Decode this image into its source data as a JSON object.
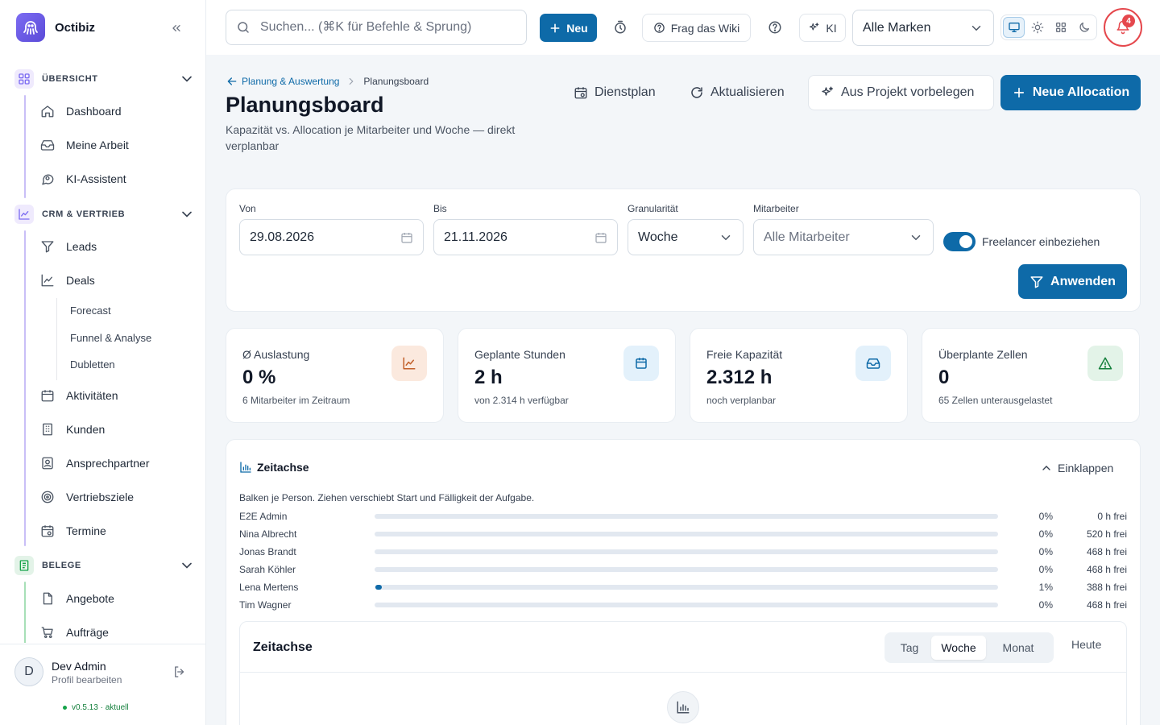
{
  "sidebar": {
    "brand": "Octibiz",
    "sections": [
      {
        "label": "ÜBERSICHT",
        "items": [
          "Dashboard",
          "Meine Arbeit",
          "KI-Assistent"
        ]
      },
      {
        "label": "CRM & VERTRIEB",
        "items": [
          "Leads",
          "Deals",
          "Aktivitäten",
          "Kunden",
          "Ansprechpartner",
          "Vertriebsziele",
          "Termine"
        ],
        "deal_subitems": [
          "Forecast",
          "Funnel & Analyse",
          "Dubletten"
        ]
      },
      {
        "label": "BELEGE",
        "items": [
          "Angebote",
          "Aufträge"
        ]
      }
    ],
    "user": {
      "initial": "D",
      "name": "Dev Admin",
      "sub": "Profil bearbeiten"
    },
    "version": "v0.5.13 · aktuell"
  },
  "topbar": {
    "search_placeholder": "Suchen... (⌘K für Befehle & Sprung)",
    "new_label": "Neu",
    "wiki_label": "Frag das Wiki",
    "ai_label": "KI",
    "brand_select": "Alle Marken",
    "notifications": "4"
  },
  "page": {
    "breadcrumb_parent": "Planung & Auswertung",
    "breadcrumb_current": "Planungsboard",
    "title": "Planungsboard",
    "subtitle": "Kapazität vs. Allocation je Mitarbeiter und Woche — direkt verplanbar",
    "actions": {
      "roster": "Dienstplan",
      "refresh": "Aktualisieren",
      "prefill": "Aus Projekt vorbelegen",
      "new_allocation": "Neue Allocation"
    }
  },
  "filters": {
    "from_label": "Von",
    "from_value": "29.08.2026",
    "to_label": "Bis",
    "to_value": "21.11.2026",
    "granularity_label": "Granularität",
    "granularity_value": "Woche",
    "employee_label": "Mitarbeiter",
    "employee_value": "Alle Mitarbeiter",
    "freelancer_label": "Freelancer einbeziehen",
    "freelancer_enabled": true,
    "apply_label": "Anwenden"
  },
  "kpis": [
    {
      "title": "Ø Auslastung",
      "value": "0 %",
      "sub": "6 Mitarbeiter im Zeitraum",
      "icon": "chart-icon",
      "color": "#c2602a",
      "bg": "#fbe9de"
    },
    {
      "title": "Geplante Stunden",
      "value": "2 h",
      "sub": "von 2.314 h verfügbar",
      "icon": "calendar-icon",
      "color": "#0e6aa8",
      "bg": "#e3f1fb"
    },
    {
      "title": "Freie Kapazität",
      "value": "2.312 h",
      "sub": "noch verplanbar",
      "icon": "inbox-icon",
      "color": "#0e6aa8",
      "bg": "#e3f1fb"
    },
    {
      "title": "Überplante Zellen",
      "value": "0",
      "sub": "65 Zellen unterausgelastet",
      "icon": "warning-icon",
      "color": "#15803d",
      "bg": "#e3f3e8"
    }
  ],
  "timeline": {
    "title": "Zeitachse",
    "collapse_label": "Einklappen",
    "description": "Balken je Person. Ziehen verschiebt Start und Fälligkeit der Aufgabe.",
    "rows": [
      {
        "name": "E2E Admin",
        "utilization": 0,
        "pct": "0%",
        "free": "0 h frei"
      },
      {
        "name": "Nina Albrecht",
        "utilization": 0,
        "pct": "0%",
        "free": "520 h frei"
      },
      {
        "name": "Jonas Brandt",
        "utilization": 0,
        "pct": "0%",
        "free": "468 h frei"
      },
      {
        "name": "Sarah Köhler",
        "utilization": 0,
        "pct": "0%",
        "free": "468 h frei"
      },
      {
        "name": "Lena Mertens",
        "utilization": 1,
        "pct": "1%",
        "free": "388 h frei"
      },
      {
        "name": "Tim Wagner",
        "utilization": 0,
        "pct": "0%",
        "free": "468 h frei"
      }
    ],
    "panel": {
      "title": "Zeitachse",
      "views": [
        "Tag",
        "Woche",
        "Monat"
      ],
      "active_view": "Woche",
      "today_label": "Heute"
    }
  }
}
